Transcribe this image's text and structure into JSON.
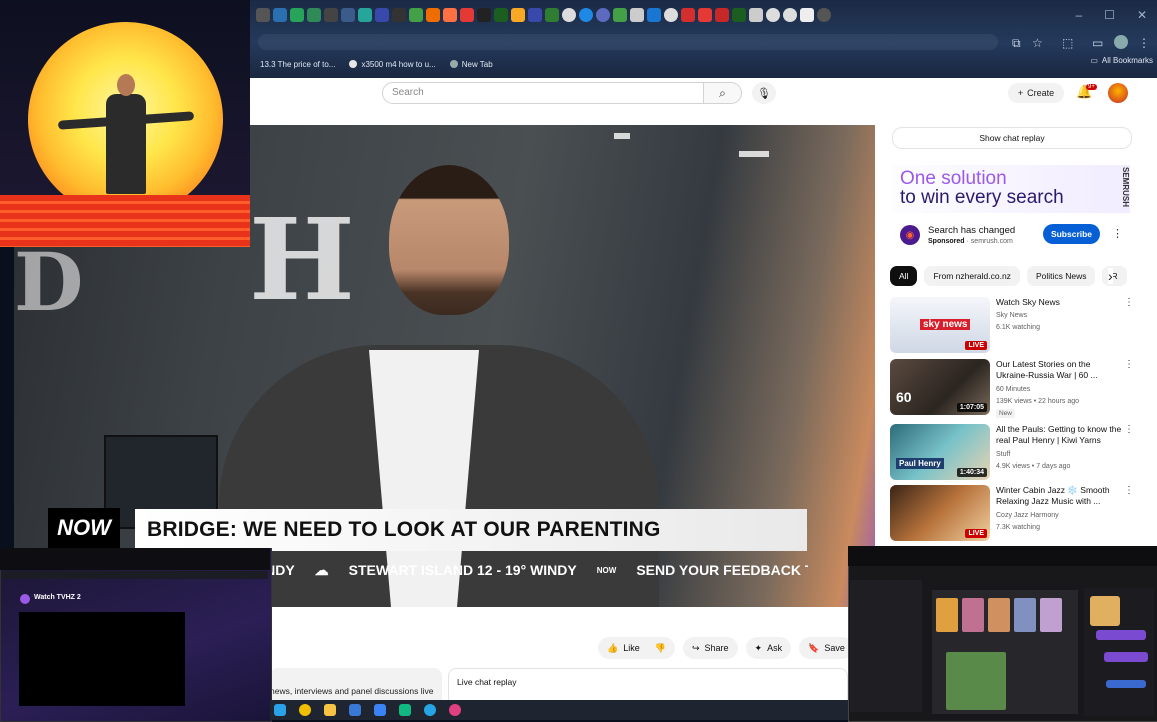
{
  "browser": {
    "tabs": [
      {
        "label": "13.3 The price of to..."
      },
      {
        "label": "x3500 m4 how to u..."
      },
      {
        "label": "New Tab"
      }
    ],
    "all_bookmarks": "All Bookmarks"
  },
  "header": {
    "search_placeholder": "Search",
    "create_label": "Create",
    "notif_count": "9+"
  },
  "video": {
    "now_label": "NOW",
    "headline": "BRIDGE: WE NEED TO LOOK AT OUR PARENTING",
    "ticker": [
      "WINDY",
      "STEWART ISLAND 12 - 19° WINDY",
      "SEND YOUR FEEDBACK TO: RYA"
    ]
  },
  "actions": {
    "like": "Like",
    "share": "Share",
    "ask": "Ask",
    "save": "Save"
  },
  "description_snippet": "news, interviews and panel discussions live",
  "live_chat_replay": "Live chat replay",
  "show_chat_replay": "Show chat replay",
  "ad": {
    "line1": "One solution",
    "line2": "to win every search",
    "brand": "SEMRUSH",
    "title": "Search has changed",
    "sponsored": "Sponsored",
    "domain": "semrush.com",
    "subscribe": "Subscribe"
  },
  "chips": [
    "All",
    "From nzherald.co.nz",
    "Politics News",
    "R"
  ],
  "recommendations": [
    {
      "title": "Watch Sky News",
      "channel": "Sky News",
      "meta": "6.1K watching",
      "badge": "LIVE",
      "thumb_text": "sky news"
    },
    {
      "title": "Our Latest Stories on the Ukraine-Russia War | 60 ...",
      "channel": "60 Minutes",
      "meta": "139K views • 22 hours ago",
      "new": "New",
      "badge": "1:07:05",
      "thumb_text": "60"
    },
    {
      "title": "All the Pauls: Getting to know the real Paul Henry | Kiwi Yarns",
      "channel": "Stuff",
      "meta": "4.9K views • 7 days ago",
      "badge": "1:40:34",
      "thumb_text": "Paul Henry"
    },
    {
      "title": "Winter Cabin Jazz ❄️ Smooth Relaxing Jazz Music with ...",
      "channel": "Cozy Jazz Harmony",
      "meta": "7.3K watching",
      "badge": "LIVE",
      "thumb_text": ""
    }
  ],
  "pip_left": {
    "title": "Watch TVHZ 2"
  },
  "colors": {
    "accent_purple": "#9b59e8",
    "subscribe_blue": "#065fd4",
    "live_red": "#cc0000"
  }
}
